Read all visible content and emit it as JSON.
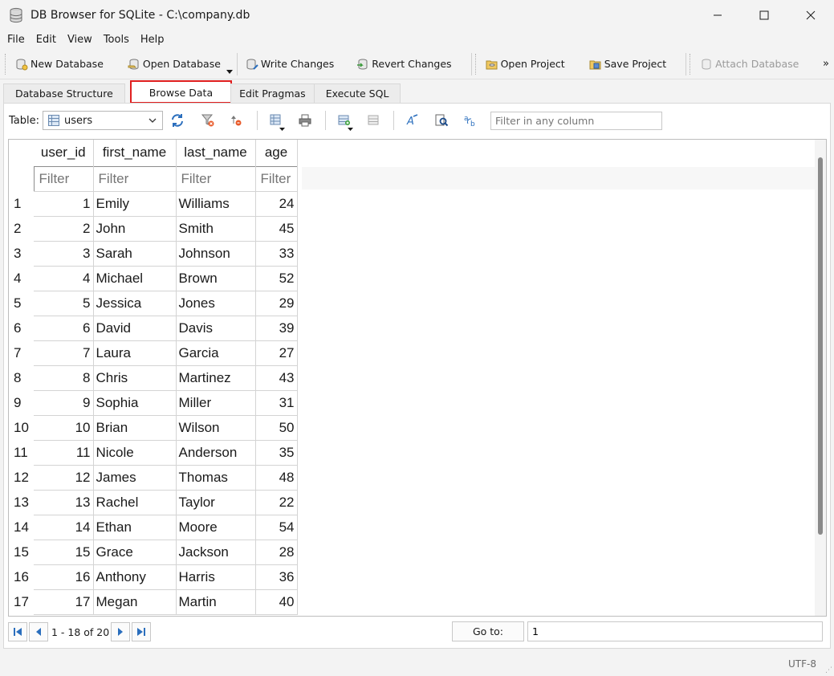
{
  "window": {
    "title": "DB Browser for SQLite - C:\\company.db",
    "minimize": "—",
    "maximize": "☐",
    "close": "✕"
  },
  "menu": [
    {
      "label": "File"
    },
    {
      "label": "Edit"
    },
    {
      "label": "View"
    },
    {
      "label": "Tools"
    },
    {
      "label": "Help"
    }
  ],
  "toolbar": {
    "new_database": "New Database",
    "open_database": "Open Database",
    "write_changes": "Write Changes",
    "revert_changes": "Revert Changes",
    "open_project": "Open Project",
    "save_project": "Save Project",
    "attach_database": "Attach Database",
    "more": "»"
  },
  "tabs": [
    {
      "label": "Database Structure",
      "active": false
    },
    {
      "label": "Browse Data",
      "active": true
    },
    {
      "label": "Edit Pragmas",
      "active": false
    },
    {
      "label": "Execute SQL",
      "active": false
    }
  ],
  "browse": {
    "table_label": "Table:",
    "table_selected": "users",
    "global_filter_placeholder": "Filter in any column"
  },
  "grid": {
    "columns": [
      "user_id",
      "first_name",
      "last_name",
      "age"
    ],
    "filter_placeholder": "Filter",
    "rows": [
      {
        "rownum": "1",
        "user_id": "1",
        "first_name": "Emily",
        "last_name": "Williams",
        "age": "24"
      },
      {
        "rownum": "2",
        "user_id": "2",
        "first_name": "John",
        "last_name": "Smith",
        "age": "45"
      },
      {
        "rownum": "3",
        "user_id": "3",
        "first_name": "Sarah",
        "last_name": "Johnson",
        "age": "33"
      },
      {
        "rownum": "4",
        "user_id": "4",
        "first_name": "Michael",
        "last_name": "Brown",
        "age": "52"
      },
      {
        "rownum": "5",
        "user_id": "5",
        "first_name": "Jessica",
        "last_name": "Jones",
        "age": "29"
      },
      {
        "rownum": "6",
        "user_id": "6",
        "first_name": "David",
        "last_name": "Davis",
        "age": "39"
      },
      {
        "rownum": "7",
        "user_id": "7",
        "first_name": "Laura",
        "last_name": "Garcia",
        "age": "27"
      },
      {
        "rownum": "8",
        "user_id": "8",
        "first_name": "Chris",
        "last_name": "Martinez",
        "age": "43"
      },
      {
        "rownum": "9",
        "user_id": "9",
        "first_name": "Sophia",
        "last_name": "Miller",
        "age": "31"
      },
      {
        "rownum": "10",
        "user_id": "10",
        "first_name": "Brian",
        "last_name": "Wilson",
        "age": "50"
      },
      {
        "rownum": "11",
        "user_id": "11",
        "first_name": "Nicole",
        "last_name": "Anderson",
        "age": "35"
      },
      {
        "rownum": "12",
        "user_id": "12",
        "first_name": "James",
        "last_name": "Thomas",
        "age": "48"
      },
      {
        "rownum": "13",
        "user_id": "13",
        "first_name": "Rachel",
        "last_name": "Taylor",
        "age": "22"
      },
      {
        "rownum": "14",
        "user_id": "14",
        "first_name": "Ethan",
        "last_name": "Moore",
        "age": "54"
      },
      {
        "rownum": "15",
        "user_id": "15",
        "first_name": "Grace",
        "last_name": "Jackson",
        "age": "28"
      },
      {
        "rownum": "16",
        "user_id": "16",
        "first_name": "Anthony",
        "last_name": "Harris",
        "age": "36"
      },
      {
        "rownum": "17",
        "user_id": "17",
        "first_name": "Megan",
        "last_name": "Martin",
        "age": "40"
      }
    ]
  },
  "navigation": {
    "page_info": "1 - 18 of 20",
    "goto_label": "Go to:",
    "goto_value": "1"
  },
  "status": {
    "encoding": "UTF-8"
  },
  "icons": {
    "app": "database-icon",
    "refresh": "refresh-icon",
    "clear_filters": "clear-filters-icon",
    "clear_sorting": "clear-sorting-icon",
    "save_table": "save-table-icon",
    "print": "print-icon",
    "insert_record": "insert-record-icon",
    "delete_record": "delete-record-icon",
    "find": "find-icon",
    "find_replace": "find-replace-icon",
    "format": "format-icon"
  },
  "colors": {
    "highlight": "#e02020",
    "accent_blue": "#2a6ebd"
  }
}
